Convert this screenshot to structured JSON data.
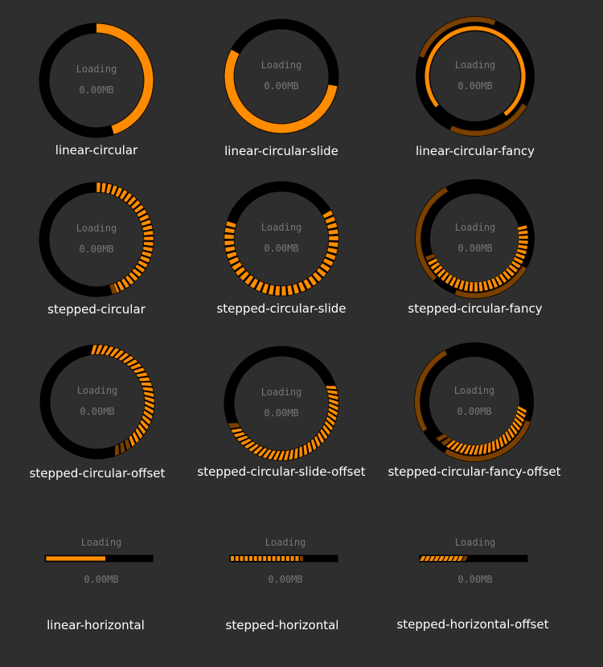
{
  "colors": {
    "background": "#2e2e2e",
    "track": "#000000",
    "accent": "#ff8c00",
    "accent_dim": "#7a4000",
    "inner_text": "#777777",
    "caption": "#ffffff"
  },
  "widgets": [
    {
      "kind": "linear-circular",
      "caption": "linear-circular",
      "loading": "Loading",
      "size": "0.00MB",
      "progress": 0.45
    },
    {
      "kind": "linear-circular-slide",
      "caption": "linear-circular-slide",
      "loading": "Loading",
      "size": "0.00MB",
      "progress": 0.55
    },
    {
      "kind": "linear-circular-fancy",
      "caption": "linear-circular-fancy",
      "loading": "Loading",
      "size": "0.00MB",
      "progress": 0.8
    },
    {
      "kind": "stepped-circular",
      "caption": "stepped-circular",
      "loading": "Loading",
      "size": "0.00MB",
      "progress": 0.45
    },
    {
      "kind": "stepped-circular-slide",
      "caption": "stepped-circular-slide",
      "loading": "Loading",
      "size": "0.00MB",
      "progress": 0.6
    },
    {
      "kind": "stepped-circular-fancy",
      "caption": "stepped-circular-fancy",
      "loading": "Loading",
      "size": "0.00MB",
      "progress": 0.8
    },
    {
      "kind": "stepped-circular-offset",
      "caption": "stepped-circular-offset",
      "loading": "Loading",
      "size": "0.00MB",
      "progress": 0.45
    },
    {
      "kind": "stepped-circular-slide-offset",
      "caption": "stepped-circular-slide-offset",
      "loading": "Loading",
      "size": "0.00MB",
      "progress": 0.5
    },
    {
      "kind": "stepped-circular-fancy-offset",
      "caption": "stepped-circular-fancy-offset",
      "loading": "Loading",
      "size": "0.00MB",
      "progress": 0.8
    },
    {
      "kind": "linear-horizontal",
      "caption": "linear-horizontal",
      "loading": "Loading",
      "size": "0.00MB",
      "progress": 0.57
    },
    {
      "kind": "stepped-horizontal",
      "caption": "stepped-horizontal",
      "loading": "Loading",
      "size": "0.00MB",
      "progress": 0.7
    },
    {
      "kind": "stepped-horizontal-offset",
      "caption": "stepped-horizontal-offset",
      "loading": "Loading",
      "size": "0.00MB",
      "progress": 0.45
    }
  ]
}
